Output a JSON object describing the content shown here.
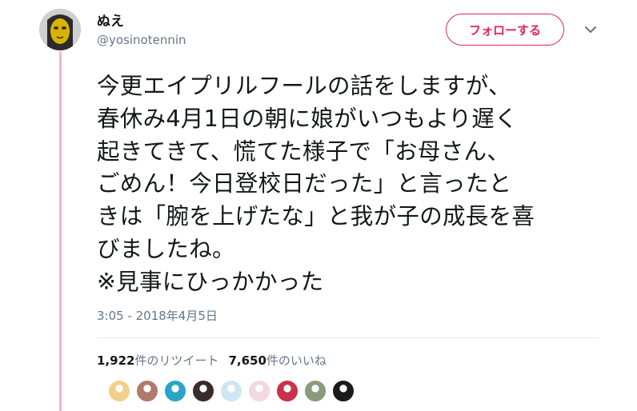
{
  "user": {
    "display_name": "ぬえ",
    "screen_name": "@yosinotennin",
    "avatar_icon": "masked-face-avatar"
  },
  "actions": {
    "follow_label": "フォローする",
    "follow_color": "#e0245e",
    "more_icon": "chevron-down-icon"
  },
  "tweet": {
    "lines": [
      "今更エイプリルフールの話をしますが、",
      "春休み4月1日の朝に娘がいつもより遅く",
      "起きてきて、慌てた様子で「お母さん、",
      "ごめん！今日登校日だった」と言ったと",
      "きは「腕を上げたな」と我が子の成長を喜",
      "びましたね。",
      "※見事にひっかかった"
    ],
    "timestamp": "3:05 - 2018年4月5日"
  },
  "stats": {
    "retweet_count": "1,922",
    "retweet_label": "件のリツイート",
    "like_count": "7,650",
    "like_label": "件のいいね"
  },
  "likers": [
    {
      "icon": "liker-avatar-1",
      "color": "#f3d08a"
    },
    {
      "icon": "liker-avatar-2",
      "color": "#b07a6a"
    },
    {
      "icon": "liker-avatar-3",
      "color": "#2aa4c8"
    },
    {
      "icon": "liker-avatar-4",
      "color": "#3a2a2a"
    },
    {
      "icon": "liker-avatar-5",
      "color": "#cfe6f5"
    },
    {
      "icon": "liker-avatar-6",
      "color": "#f2d8e0"
    },
    {
      "icon": "liker-avatar-7",
      "color": "#c8324a"
    },
    {
      "icon": "liker-avatar-8",
      "color": "#8a9a7a"
    },
    {
      "icon": "liker-avatar-9",
      "color": "#1a1a1a"
    }
  ]
}
